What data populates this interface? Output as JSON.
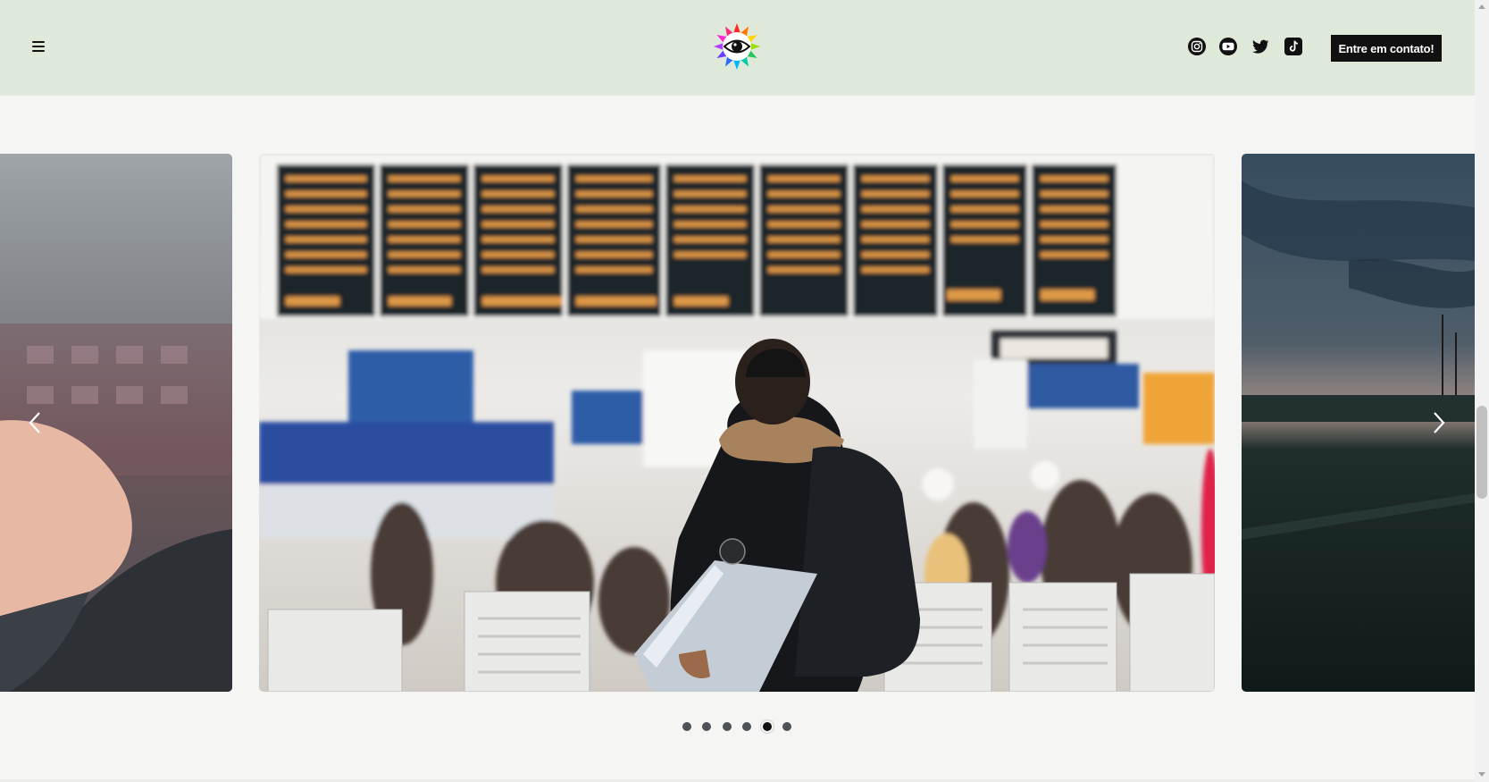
{
  "header": {
    "menu_icon": "hamburger-icon",
    "logo_icon": "rainbow-eye-logo-icon",
    "social": [
      "instagram-icon",
      "youtube-icon",
      "twitter-icon",
      "tiktok-icon"
    ],
    "contact_label": "Entre em contato!"
  },
  "carousel": {
    "slides": [
      "hand-closeup-photo",
      "airport-traveler-photo",
      "sunset-field-photo"
    ],
    "prev_icon": "chevron-left-icon",
    "next_icon": "chevron-right-icon",
    "dot_count": 6,
    "active_dot": 5
  },
  "colors": {
    "header_bg": "#dfe9d9",
    "page_bg": "#f5f5f3",
    "button_bg": "#111111",
    "button_text": "#ffffff"
  }
}
